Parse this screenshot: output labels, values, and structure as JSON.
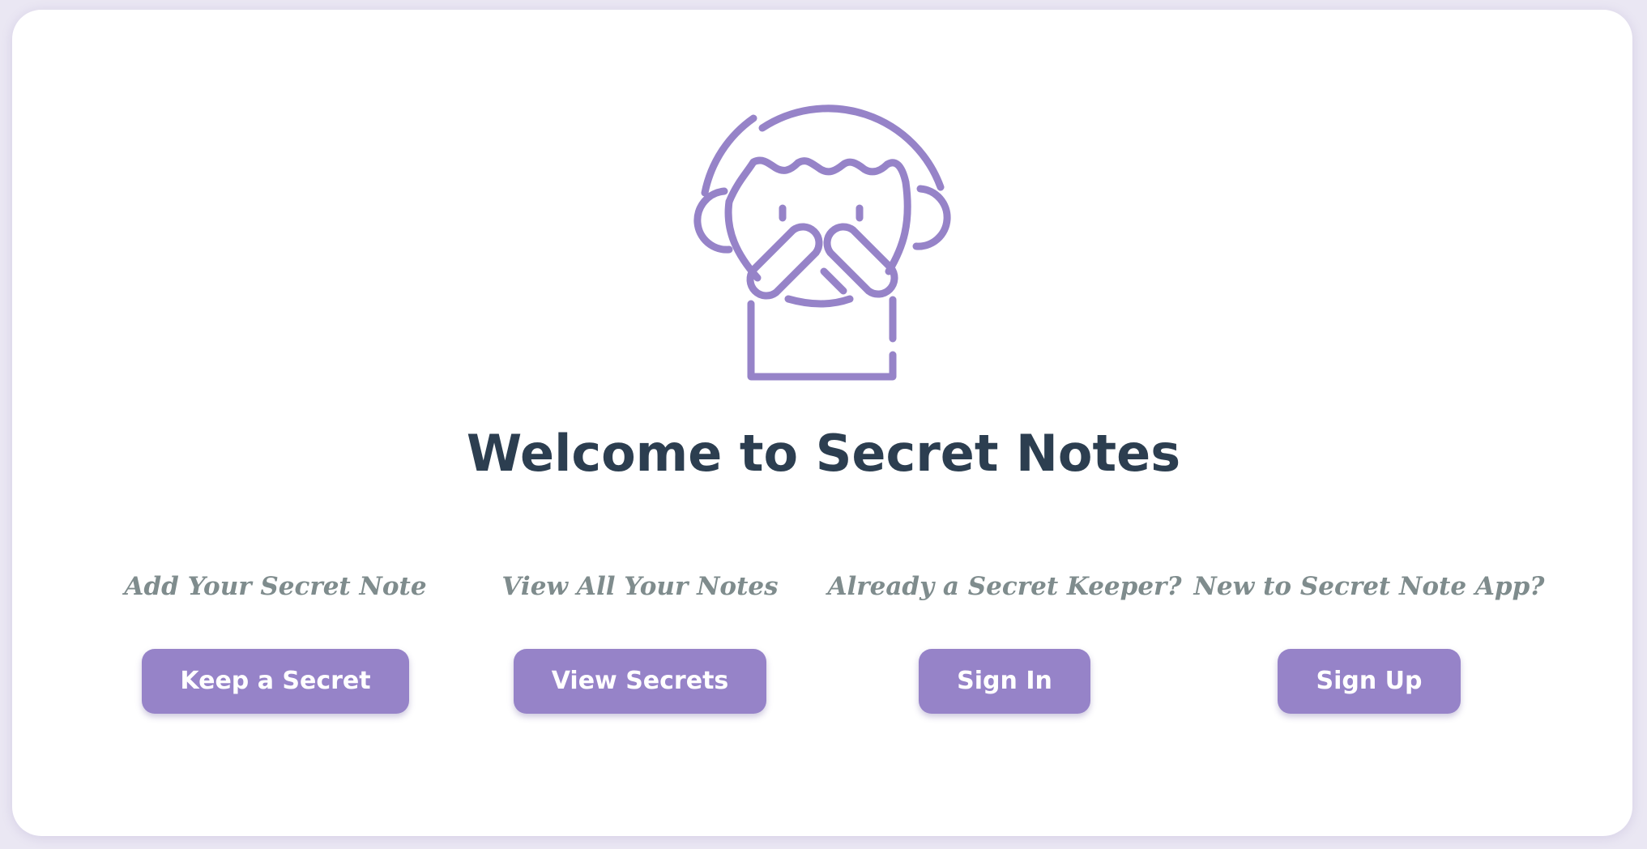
{
  "header": {
    "title": "Welcome to Secret Notes",
    "mascot_icon": "speak-no-evil-person-icon"
  },
  "actions": [
    {
      "caption": "Add Your Secret Note",
      "button_label": "Keep a Secret"
    },
    {
      "caption": "View All Your Notes",
      "button_label": "View Secrets"
    },
    {
      "caption": "Already a Secret Keeper?",
      "button_label": "Sign In"
    },
    {
      "caption": "New to Secret Note App?",
      "button_label": "Sign Up"
    }
  ],
  "colors": {
    "accent": "#9683c8",
    "title": "#2c3e50",
    "caption": "#7f8c8d",
    "background": "#eae7f3"
  }
}
